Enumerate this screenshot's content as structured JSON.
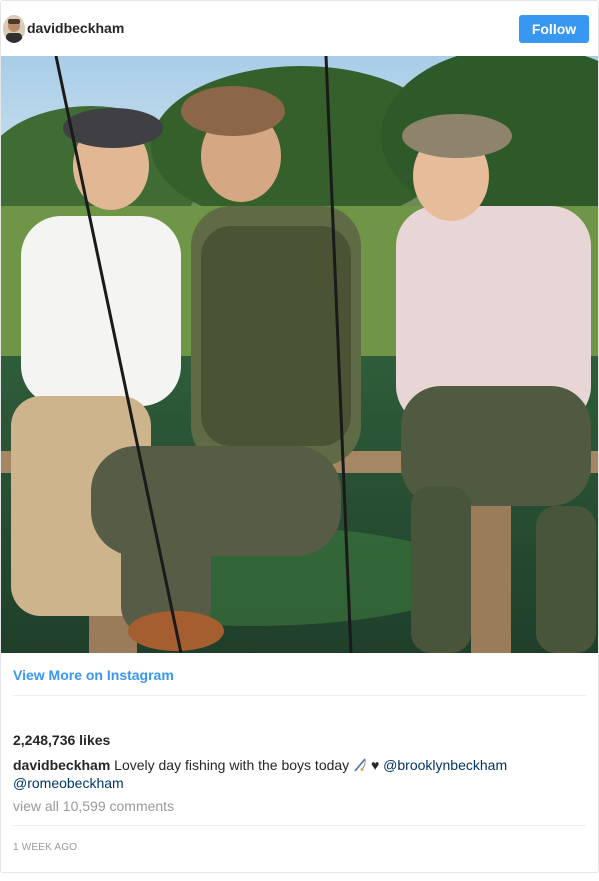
{
  "header": {
    "username": "davidbeckham",
    "follow_label": "Follow"
  },
  "photo": {
    "subject": "three people in flat caps seated on a wooden fence by a river"
  },
  "footer": {
    "view_more_label": "View More on Instagram",
    "likes": "2,248,736 likes",
    "caption_user": "davidbeckham",
    "caption_text": " Lovely day fishing with the boys today ",
    "caption_heart": "♥",
    "mention_1": "@brooklynbeckham",
    "mention_2": "@romeobeckham",
    "comments_label": "view all 10,599 comments",
    "timestamp": "1 WEEK AGO"
  },
  "colors": {
    "accent": "#3897f0",
    "mention": "#003569",
    "muted": "#999999",
    "text": "#262626"
  },
  "icons": [
    "avatar-photo",
    "fishing-pole-icon"
  ]
}
